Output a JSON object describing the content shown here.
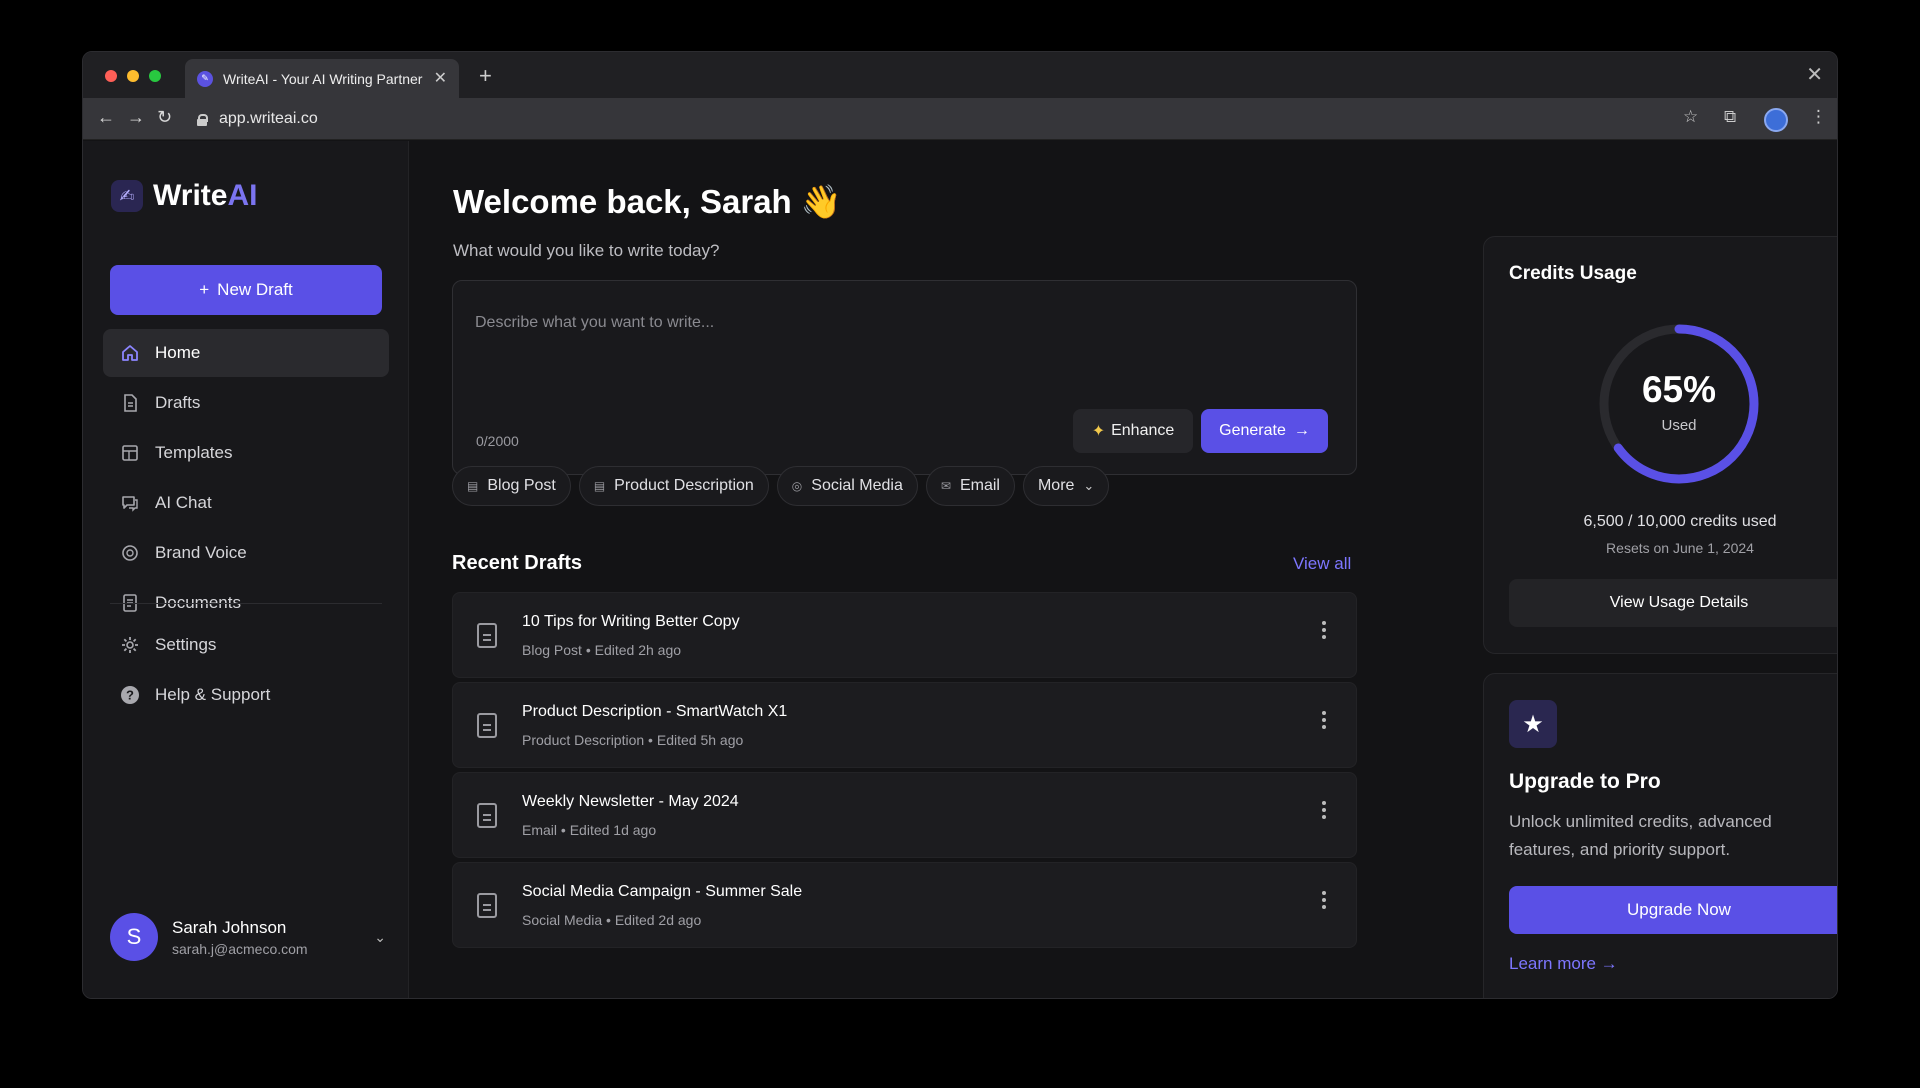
{
  "browser": {
    "tab_title": "WriteAI - Your AI Writing Partner",
    "url": "app.writeai.co"
  },
  "sidebar": {
    "logo_main": "Write",
    "logo_accent": "AI",
    "new_draft": "New Draft",
    "items": [
      {
        "label": "Home",
        "icon": "home-icon",
        "active": true
      },
      {
        "label": "Drafts",
        "icon": "document-icon"
      },
      {
        "label": "Templates",
        "icon": "template-icon"
      },
      {
        "label": "AI Chat",
        "icon": "chat-icon"
      },
      {
        "label": "Brand Voice",
        "icon": "brand-voice-icon"
      },
      {
        "label": "Documents",
        "icon": "documents-icon"
      }
    ],
    "secondary": [
      {
        "label": "Settings",
        "icon": "gear-icon"
      },
      {
        "label": "Help & Support",
        "icon": "help-icon"
      }
    ],
    "user": {
      "initial": "S",
      "name": "Sarah Johnson",
      "email": "sarah.j@acmeco.com"
    }
  },
  "main": {
    "welcome": "Welcome back, Sarah 👋",
    "subtitle": "What would you like to write today?",
    "prompt_placeholder": "Describe what you want to write...",
    "counter": "0/2000",
    "enhance": "Enhance",
    "generate": "Generate",
    "chips": [
      "Blog Post",
      "Product Description",
      "Social Media",
      "Email",
      "More"
    ],
    "recent_title": "Recent Drafts",
    "view_all": "View all",
    "drafts": [
      {
        "title": "10 Tips for Writing Better Copy",
        "type": "Blog Post",
        "edited": "Edited 2h ago"
      },
      {
        "title": "Product Description - SmartWatch X1",
        "type": "Product Description",
        "edited": "Edited 5h ago"
      },
      {
        "title": "Weekly Newsletter - May 2024",
        "type": "Email",
        "edited": "Edited 1d ago"
      },
      {
        "title": "Social Media Campaign - Summer Sale",
        "type": "Social Media",
        "edited": "Edited 2d ago"
      }
    ]
  },
  "credits": {
    "title": "Credits Usage",
    "percent_label": "65%",
    "percent_value": 0.65,
    "used_label": "Used",
    "credits_used": "6,500 / 10,000 credits used",
    "resets": "Resets on June 1, 2024",
    "button": "View Usage Details"
  },
  "pro": {
    "title": "Upgrade to Pro",
    "description": "Unlock unlimited credits, advanced features, and priority support.",
    "button": "Upgrade Now",
    "learn_more": "Learn more"
  },
  "colors": {
    "accent": "#5a50e6",
    "link": "#7d76ff"
  }
}
